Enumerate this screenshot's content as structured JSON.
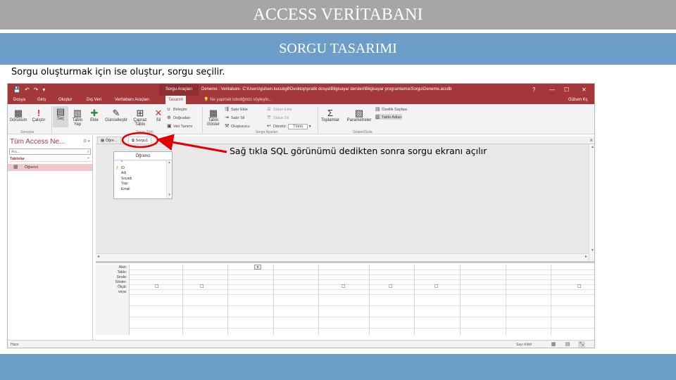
{
  "slide": {
    "title": "ACCESS VERİTABANI",
    "subtitle": "SORGU TASARIMI",
    "caption": "Sorgu oluşturmak için ise oluştur, sorgu seçilir.",
    "annotation": "Sağ tıkla SQL görünümü dedikten sonra sorgu ekranı açılır"
  },
  "access": {
    "context_tab": "Sorgu Araçları",
    "window_title": "Deneme : Veritabanı- C:\\Users\\gulsen.kucukgil\\Desktop\\pratik dosya\\Bilgisayar dersleri\\Bilgisayar programlama\\Sorgu\\Deneme.accdb",
    "user": "Gülsen Kç",
    "window_controls": [
      "?",
      "—",
      "☐",
      "✕"
    ],
    "tabs": [
      "Dosya",
      "Giriş",
      "Oluştur",
      "Dış Veri",
      "Veritabanı Araçları",
      "Tasarım"
    ],
    "active_tab": "Tasarım",
    "tell_me": "Ne yapmak istediğinizi söyleyin...",
    "ribbon": {
      "buttons": [
        {
          "label": "Görünüm",
          "icon": "view-icon"
        },
        {
          "label": "Çalıştır",
          "icon": "run-icon"
        },
        {
          "label": "Seç",
          "icon": "select-icon"
        },
        {
          "label": "Tablo Yap",
          "icon": "make-table-icon"
        },
        {
          "label": "Ekle",
          "icon": "append-icon"
        },
        {
          "label": "Güncelleştir",
          "icon": "update-icon"
        },
        {
          "label": "Çapraz Tablo",
          "icon": "crosstab-icon"
        },
        {
          "label": "Sil",
          "icon": "delete-icon"
        }
      ],
      "small_query_type": [
        "Birleşim",
        "Doğrudan",
        "Veri Tanımı"
      ],
      "show_table": "Tablo Göster",
      "setup_rows": [
        "Satır Ekle",
        "Satır Sil",
        "Oluşturucu"
      ],
      "setup_cols": [
        "Sütun Ekle",
        "Sütun Sil"
      ],
      "return_label": "Döndür:",
      "return_value": "Tümü",
      "totals": "Toplamlar",
      "parameters": "Parametreler",
      "property_sheet": "Özellik Sayfası",
      "table_names": "Tablo Adları",
      "groups": [
        "Sonuçlar",
        "Sorgu Türü",
        "Sorgu Ayarları",
        "Göster/Gizle"
      ]
    },
    "nav": {
      "title": "Tüm Access Ne...",
      "search_placeholder": "Ara...",
      "section": "Tablolar",
      "item": "Öğrenci"
    },
    "query_tab": "Sorgu1",
    "object_tab": "Öğre...",
    "table_box": {
      "title": "Öğrenci",
      "fields": [
        "*",
        "ID",
        "Adı",
        "Soyadı",
        "Yaşı",
        "Email"
      ]
    },
    "grid_labels": [
      "Alan:",
      "Tablo:",
      "Sırala:",
      "Göster:",
      "Ölçüt:",
      "veya:"
    ],
    "status_left": "Hazır",
    "status_right": "Sayı Kilidi"
  }
}
